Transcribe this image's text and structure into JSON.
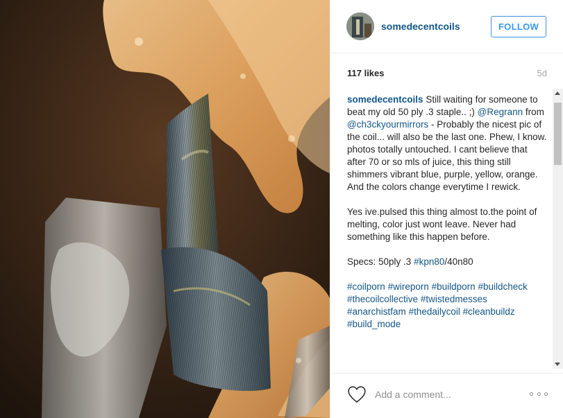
{
  "post": {
    "username": "somedecentcoils",
    "follow_label": "FOLLOW",
    "likes": "117 likes",
    "age": "5d"
  },
  "caption": {
    "username": "somedecentcoils",
    "line1_a": "Still waiting for someone to beat my old 50 ply .3 staple.. ;)",
    "mention1": "@Regrann",
    "line1_b": "from",
    "mention2": "@ch3ckyourmirrors",
    "line1_c": "- Probably the nicest pic of the coil... will also be the last one. Phew, I know. photos totally untouched. I cant believe that after 70 or so mls of juice, this thing still shimmers vibrant blue, purple, yellow, orange. And the colors change everytime I rewick.",
    "para2": "Yes ive.pulsed this thing almost to.the point of melting, color just wont leave. Never had something like this happen before.",
    "specs_a": "Specs: 50ply .3",
    "specs_tag": "#kpn80",
    "specs_b": "/40n80",
    "hashtags": [
      "#coilporn",
      "#wireporn",
      "#buildporn",
      "#buildcheck",
      "#thecoilcollective",
      "#twistedmesses",
      "#anarchistfam",
      "#thedailycoil",
      "#cleanbuildz",
      "#build_mode"
    ]
  },
  "footer": {
    "comment_placeholder": "Add a comment..."
  },
  "icons": {
    "like": "heart-icon",
    "more": "more-options-icon"
  }
}
